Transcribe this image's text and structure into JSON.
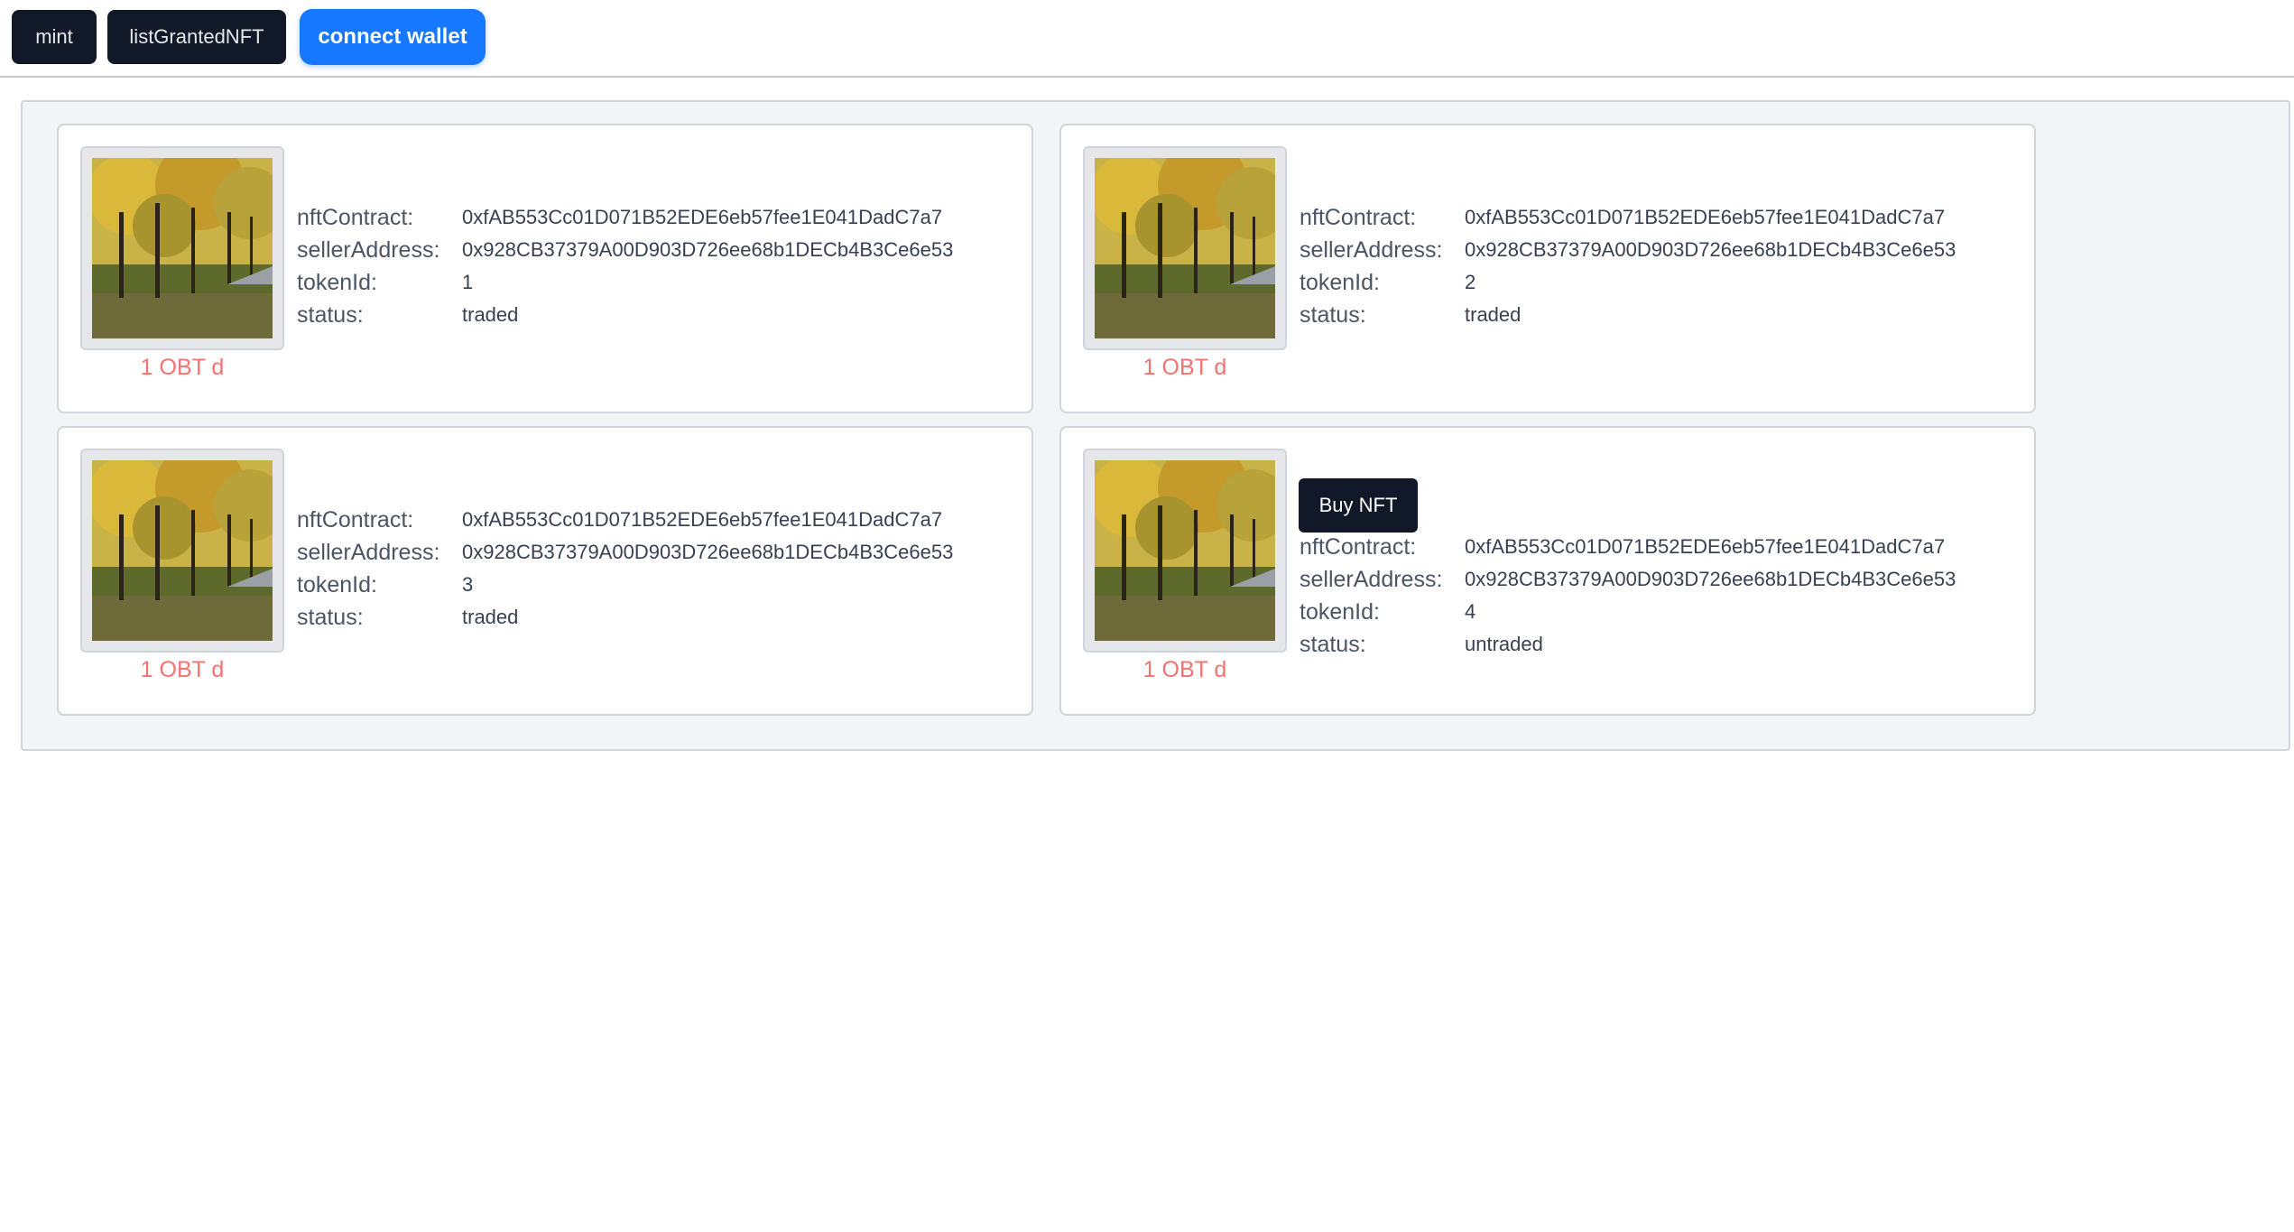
{
  "toolbar": {
    "mint_label": "mint",
    "list_label": "listGrantedNFT",
    "connect_label": "connect wallet"
  },
  "labels": {
    "nft_contract": "nftContract:",
    "seller_address": "sellerAddress:",
    "token_id": "tokenId:",
    "status": "status:",
    "buy": "Buy NFT"
  },
  "cards": [
    {
      "price": "1 OBT d",
      "nft_contract": "0xfAB553Cc01D071B52EDE6eb57fee1E041DadC7a7",
      "seller_address": "0x928CB37379A00D903D726ee68b1DECb4B3Ce6e53",
      "token_id": "1",
      "status": "traded"
    },
    {
      "price": "1 OBT d",
      "nft_contract": "0xfAB553Cc01D071B52EDE6eb57fee1E041DadC7a7",
      "seller_address": "0x928CB37379A00D903D726ee68b1DECb4B3Ce6e53",
      "token_id": "2",
      "status": "traded"
    },
    {
      "price": "1 OBT d",
      "nft_contract": "0xfAB553Cc01D071B52EDE6eb57fee1E041DadC7a7",
      "seller_address": "0x928CB37379A00D903D726ee68b1DECb4B3Ce6e53",
      "token_id": "3",
      "status": "traded"
    },
    {
      "price": "1 OBT d",
      "nft_contract": "0xfAB553Cc01D071B52EDE6eb57fee1E041DadC7a7",
      "seller_address": "0x928CB37379A00D903D726ee68b1DECb4B3Ce6e53",
      "token_id": "4",
      "status": "untraded"
    }
  ],
  "colors": {
    "dark_button": "#111827",
    "connect_button": "#1677ff",
    "price_text": "#f87171",
    "panel_bg": "#f3f4f6"
  },
  "icons": {
    "thumbnail": "autumn-trees-photo-icon"
  }
}
